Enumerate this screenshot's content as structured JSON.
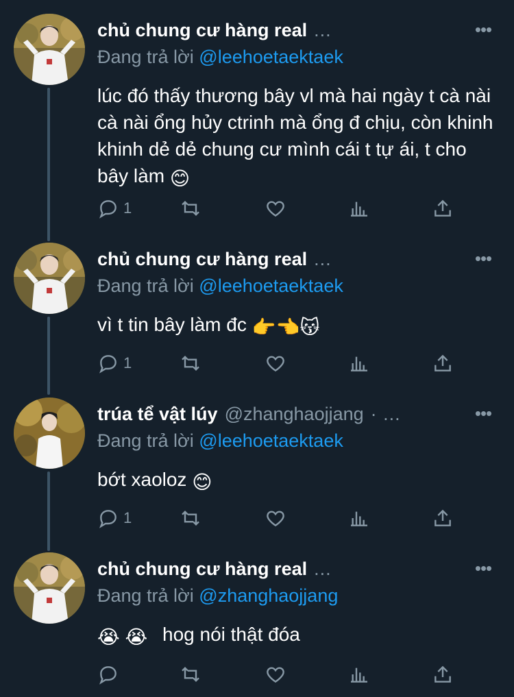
{
  "tweets": [
    {
      "name": "chủ chung cư hàng real",
      "handle": "",
      "header_suffix": "...",
      "reply_prefix": "Đang trả lời",
      "reply_to": "@leehoetaektaek",
      "text": "lúc đó thấy thương bây vl mà hai ngày t cà nài cà nài ổng hủy ctrinh mà ổng đ chịu, còn khinh khinh dẻ dẻ chung cư mình cái t tự ái, t cho bây làm",
      "emoji": "😊",
      "reply_count": "1",
      "icons": [
        "reply-icon",
        "retweet-icon",
        "like-icon",
        "analytics-icon",
        "share-icon"
      ]
    },
    {
      "name": "chủ chung cư hàng real",
      "handle": "",
      "header_suffix": "...",
      "reply_prefix": "Đang trả lời",
      "reply_to": "@leehoetaektaek",
      "text": "vì t tin bây làm đc",
      "emoji": "👉👈😽",
      "reply_count": "1"
    },
    {
      "name": "trúa tể vật lúy",
      "handle": "@zhanghaojjang",
      "header_suffix": "· ...",
      "reply_prefix": "Đang trả lời",
      "reply_to": "@leehoetaektaek",
      "text": "bớt xaoloz",
      "emoji": "😊",
      "reply_count": "1"
    },
    {
      "name": "chủ chung cư hàng real",
      "handle": "",
      "header_suffix": "...",
      "reply_prefix": "Đang trả lời",
      "reply_to": "@zhanghaojjang",
      "text": "hog nói thật đóa",
      "emoji_before": "😭 😭",
      "reply_count": ""
    }
  ],
  "more_label": "•••",
  "colors": {
    "background": "#15202b",
    "muted": "#8899a6",
    "link": "#1d9bf0",
    "connector": "#3d5466"
  }
}
